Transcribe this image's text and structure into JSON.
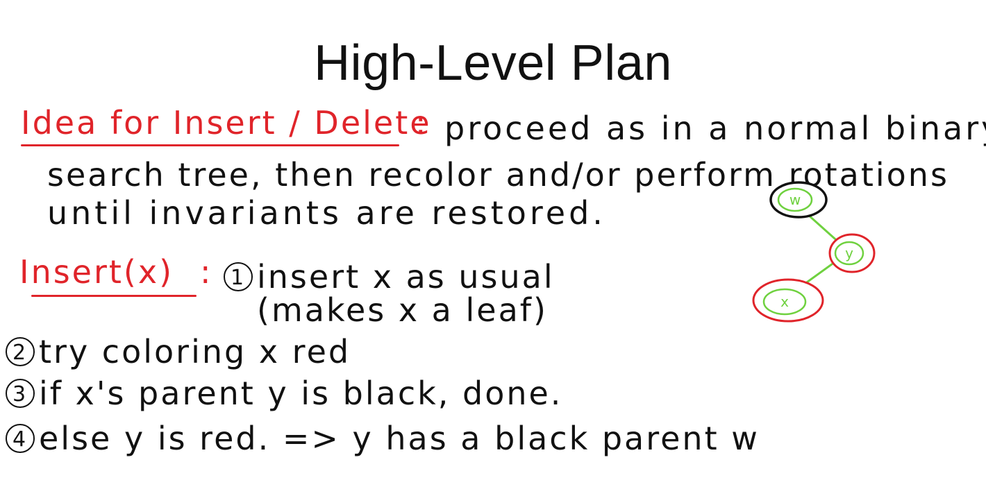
{
  "title": "High-Level Plan",
  "idea": {
    "label": "Idea for Insert / Delete",
    "colon": ":",
    "line1": "proceed as in a normal binary",
    "line2": "search tree, then recolor and/or perform rotations",
    "line3": "until invariants are restored."
  },
  "insert": {
    "label": "Insert(x)",
    "colon": ":",
    "step1_num": "1",
    "step1_line1": "insert x as usual",
    "step1_line2": "(makes x a leaf)",
    "step2_num": "2",
    "step2": "try coloring x red",
    "step3_num": "3",
    "step3": "if x's parent y is black, done.",
    "step4_num": "4",
    "step4": "else y is red. => y has a black parent w"
  },
  "tree": {
    "nodes": [
      {
        "label": "w",
        "color": "black"
      },
      {
        "label": "y",
        "color": "red"
      },
      {
        "label": "x",
        "color": "red"
      }
    ],
    "edge_color": "#6fd13f",
    "red_color": "#e0242a",
    "black_color": "#111111"
  }
}
